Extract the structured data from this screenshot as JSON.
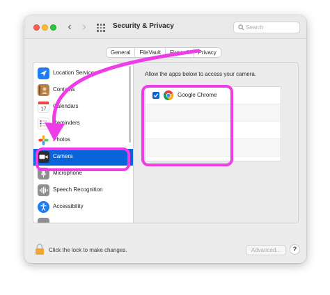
{
  "window": {
    "title": "Security & Privacy",
    "search_placeholder": "Search"
  },
  "tabs": [
    {
      "label": "General"
    },
    {
      "label": "FileVault"
    },
    {
      "label": "Firewall"
    },
    {
      "label": "Privacy",
      "active": true
    }
  ],
  "sidebar": {
    "items": [
      {
        "label": "Location Services",
        "icon": "location-arrow-icon",
        "color": "#1f7cf2"
      },
      {
        "label": "Contacts",
        "icon": "contacts-book-icon",
        "color": "#b5804a"
      },
      {
        "label": "Calendars",
        "icon": "calendar-icon",
        "color": "#ffffff"
      },
      {
        "label": "Reminders",
        "icon": "reminders-list-icon",
        "color": "#ffffff"
      },
      {
        "label": "Photos",
        "icon": "photos-flower-icon",
        "color": "#ffffff"
      },
      {
        "label": "Camera",
        "icon": "camera-icon",
        "color": "#1c1c1e",
        "selected": true
      },
      {
        "label": "Microphone",
        "icon": "microphone-icon",
        "color": "#8e8e93"
      },
      {
        "label": "Speech Recognition",
        "icon": "speech-waveform-icon",
        "color": "#8e8e93"
      },
      {
        "label": "Accessibility",
        "icon": "accessibility-icon",
        "color": "#1f7cf2"
      }
    ]
  },
  "main": {
    "allow_text": "Allow the apps below to access your camera.",
    "apps": [
      {
        "name": "Google Chrome",
        "checked": true
      }
    ]
  },
  "footer": {
    "lock_text": "Click the lock to make changes.",
    "advanced_label": "Advanced...",
    "help_label": "?"
  },
  "colors": {
    "selection_blue": "#0a64d9",
    "annotation_magenta": "#ee3ce8"
  }
}
